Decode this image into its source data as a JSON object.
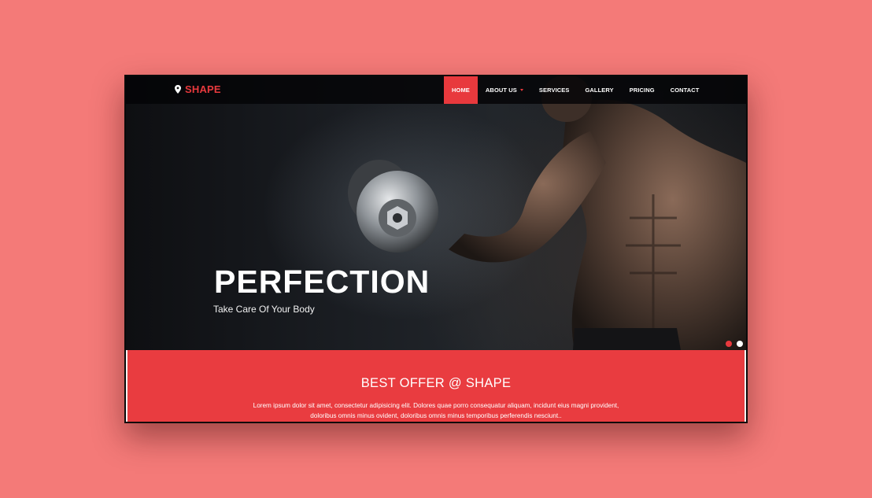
{
  "brand": {
    "name": "SHAPE",
    "icon": "map-pin-icon",
    "color": "#e8393d"
  },
  "nav": {
    "items": [
      {
        "label": "HOME",
        "active": true,
        "dropdown": false
      },
      {
        "label": "ABOUT US",
        "active": false,
        "dropdown": true
      },
      {
        "label": "SERVICES",
        "active": false,
        "dropdown": false
      },
      {
        "label": "GALLERY",
        "active": false,
        "dropdown": false
      },
      {
        "label": "PRICING",
        "active": false,
        "dropdown": false
      },
      {
        "label": "CONTACT",
        "active": false,
        "dropdown": false
      }
    ]
  },
  "hero": {
    "title": "PERFECTION",
    "subtitle": "Take Care Of Your Body",
    "slides": {
      "count": 2,
      "active_index": 0
    }
  },
  "offer": {
    "title": "BEST OFFER @ SHAPE",
    "text_line1": "Lorem ipsum dolor sit amet, consectetur adipisicing elit. Dolores quae porro consequatur aliquam, incidunt eius magni provident,",
    "text_line2": "doloribus omnis minus ovident, doloribus omnis minus temporibus perferendis nesciunt.."
  },
  "colors": {
    "page_background": "#f47a78",
    "accent": "#e8393d",
    "offer_background": "#e93c40"
  }
}
